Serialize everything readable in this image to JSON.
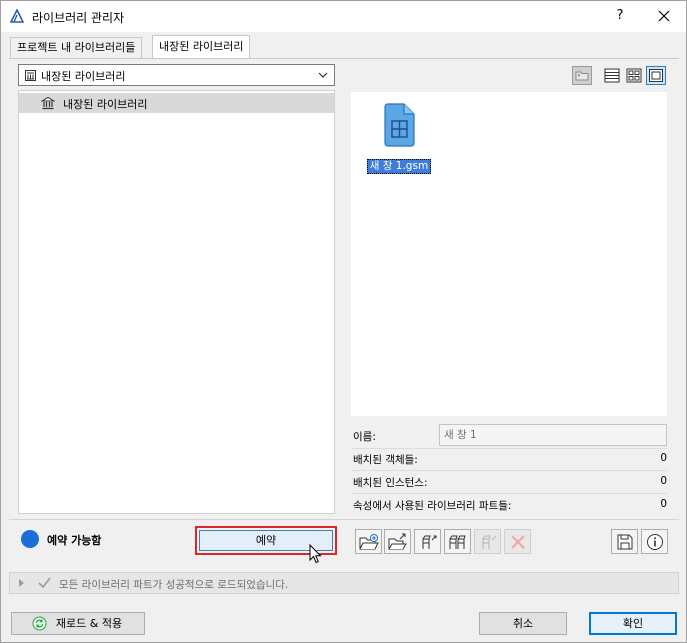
{
  "window": {
    "title": "라이브러리 관리자",
    "help_label": "?",
    "icons": {
      "app": "archicad-icon",
      "close": "close-icon"
    }
  },
  "tabs": [
    {
      "label": "프로젝트 내 라이브러리들",
      "active": false
    },
    {
      "label": "내장된 라이브러리",
      "active": true
    }
  ],
  "library_select": {
    "value": "내장된 라이브러리",
    "icon": "library-icon"
  },
  "tree": {
    "items": [
      {
        "label": "내장된 라이브러리",
        "selected": true
      }
    ]
  },
  "view_buttons": [
    "parent-folder-icon",
    "list-view-icon",
    "grid-view-icon",
    "large-icon-view-icon"
  ],
  "preview": {
    "file_name": "새 창 1.gsm",
    "file_icon": "window-object-file-icon"
  },
  "properties": {
    "name_label": "이름:",
    "name_value": "새 창 1",
    "placed_objects_label": "배치된 객체들:",
    "placed_objects_value": "0",
    "placed_instances_label": "배치된 인스턴스:",
    "placed_instances_value": "0",
    "used_parts_label": "속성에서 사용된 라이브러리 파트들:",
    "used_parts_value": "0"
  },
  "reservation": {
    "status": "예약 가능함",
    "status_color": "#1b6ed8",
    "reserve_label": "예약"
  },
  "toolbar": [
    "open-folder-add-icon",
    "export-folder-icon",
    "reserve-object-icon",
    "release-objects-icon",
    "request-object-icon",
    "delete-icon",
    "save-icon",
    "info-icon"
  ],
  "statusbar": {
    "message": "모든 라이브러리 파트가 성공적으로 로드되었습니다."
  },
  "buttons": {
    "reload": "재로드 & 적용",
    "cancel": "취소",
    "ok": "확인"
  },
  "colors": {
    "accent": "#0078d7",
    "highlight": "#e0242a",
    "selection": "#3e7ed8"
  }
}
